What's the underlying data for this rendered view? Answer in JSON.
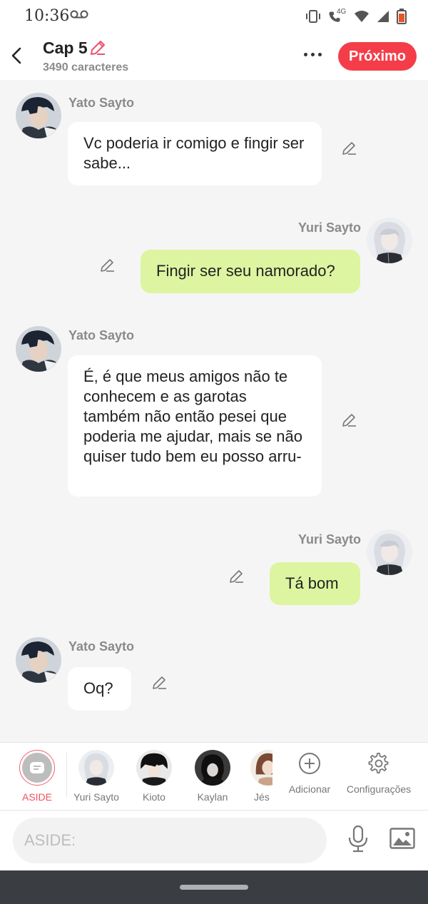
{
  "status_bar": {
    "time": "10:36",
    "network": "4G"
  },
  "header": {
    "title": "Cap 5",
    "subtitle": "3490 caracteres",
    "next_label": "Próximo"
  },
  "messages": [
    {
      "side": "left",
      "author": "Yato Sayto",
      "text": "Vc poderia ir comigo e fingir ser sabe..."
    },
    {
      "side": "right",
      "author": "Yuri Sayto",
      "text": "Fingir ser seu namorado?"
    },
    {
      "side": "left",
      "author": "Yato Sayto",
      "text": "É, é que meus amigos não te conhecem e as garotas também não então pesei que poderia me ajudar, mais se não quiser tudo bem eu posso arru-"
    },
    {
      "side": "right",
      "author": "Yuri Sayto",
      "text": "Tá bom"
    },
    {
      "side": "left",
      "author": "Yato Sayto",
      "text": "Oq?"
    }
  ],
  "characters": [
    {
      "label": "ASIDE"
    },
    {
      "label": "Yuri Sayto"
    },
    {
      "label": "Kioto"
    },
    {
      "label": "Kaylan"
    },
    {
      "label": "Jés"
    }
  ],
  "tools": {
    "add_label": "Adicionar",
    "settings_label": "Configurações"
  },
  "composer": {
    "placeholder": "ASIDE:"
  },
  "colors": {
    "accent": "#f53d4a",
    "right_bubble": "#ddf5a0",
    "left_bubble": "#ffffff",
    "aside_label": "#f05060"
  }
}
